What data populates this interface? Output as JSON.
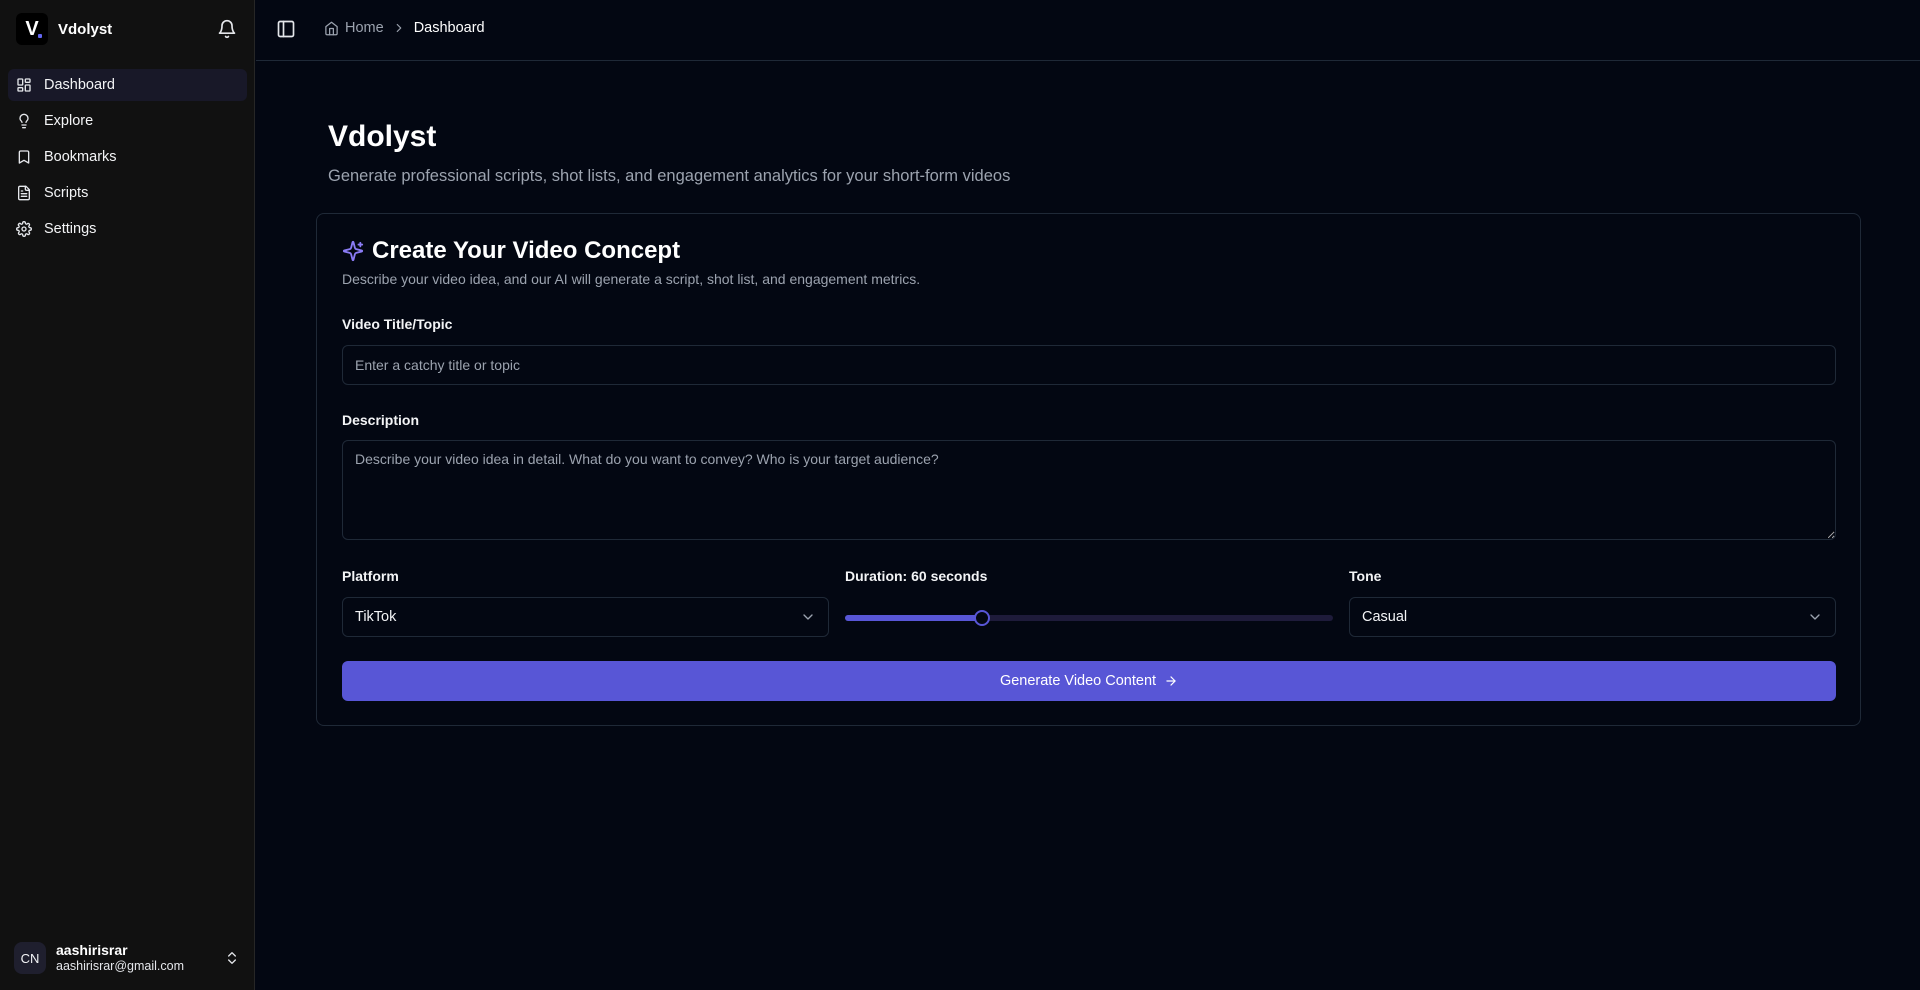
{
  "sidebar": {
    "brand": {
      "logo_letter": "V",
      "name": "Vdolyst"
    },
    "items": [
      {
        "label": "Dashboard",
        "icon": "layout-dashboard-icon",
        "active": true
      },
      {
        "label": "Explore",
        "icon": "lightbulb-icon",
        "active": false
      },
      {
        "label": "Bookmarks",
        "icon": "bookmark-icon",
        "active": false
      },
      {
        "label": "Scripts",
        "icon": "file-text-icon",
        "active": false
      },
      {
        "label": "Settings",
        "icon": "gear-icon",
        "active": false
      }
    ],
    "user": {
      "initials": "CN",
      "name": "aashirisrar",
      "email": "aashirisrar@gmail.com"
    }
  },
  "topbar": {
    "breadcrumb": {
      "home": "Home",
      "current": "Dashboard"
    }
  },
  "main": {
    "title": "Vdolyst",
    "subtitle": "Generate professional scripts, shot lists, and engagement analytics for your short-form videos",
    "card": {
      "title": "Create Your Video Concept",
      "description": "Describe your video idea, and our AI will generate a script, shot list, and engagement metrics.",
      "title_field": {
        "label": "Video Title/Topic",
        "value": "",
        "placeholder": "Enter a catchy title or topic"
      },
      "description_field": {
        "label": "Description",
        "value": "",
        "placeholder": "Describe your video idea in detail. What do you want to convey? Who is your target audience?"
      },
      "platform": {
        "label": "Platform",
        "value": "TikTok"
      },
      "duration": {
        "label": "Duration: 60 seconds",
        "value": 60,
        "fraction": 0.28
      },
      "tone": {
        "label": "Tone",
        "value": "Casual"
      },
      "submit_label": "Generate Video Content"
    }
  },
  "colors": {
    "accent": "#5856d6",
    "background": "#030712",
    "sidebar": "#111111",
    "border": "#1f2937"
  }
}
